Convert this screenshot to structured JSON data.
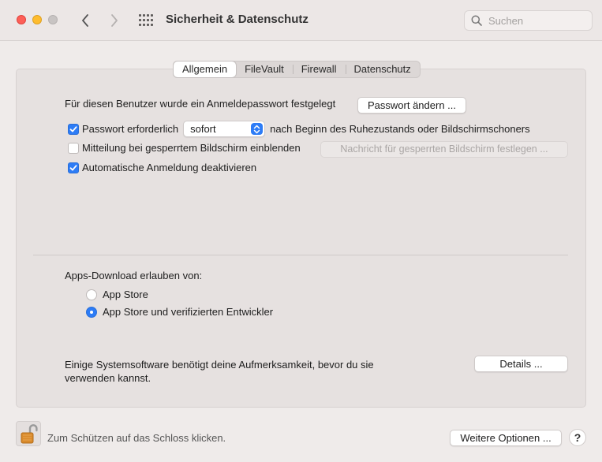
{
  "window": {
    "title": "Sicherheit & Datenschutz",
    "search_placeholder": "Suchen"
  },
  "tabs": [
    {
      "label": "Allgemein",
      "active": true
    },
    {
      "label": "FileVault",
      "active": false
    },
    {
      "label": "Firewall",
      "active": false
    },
    {
      "label": "Datenschutz",
      "active": false
    }
  ],
  "general": {
    "password_set_text": "Für diesen Benutzer wurde ein Anmeldepasswort festgelegt",
    "change_password_button": "Passwort ändern ...",
    "require_password_label": "Passwort erforderlich",
    "require_password_checked": true,
    "require_password_select": "sofort",
    "require_password_suffix": "nach Beginn des Ruhezustands oder Bildschirmschoners",
    "lock_message_label": "Mitteilung bei gesperrtem Bildschirm einblenden",
    "lock_message_checked": false,
    "lock_message_button": "Nachricht für gesperrten Bildschirm festlegen ...",
    "disable_autologin_label": "Automatische Anmeldung deaktivieren",
    "disable_autologin_checked": true
  },
  "downloads": {
    "heading": "Apps-Download erlauben von:",
    "options": [
      {
        "label": "App Store",
        "selected": false
      },
      {
        "label": "App Store und verifizierten Entwickler",
        "selected": true
      }
    ]
  },
  "system_software": {
    "text_line1": "Einige Systemsoftware benötigt deine Aufmerksamkeit, bevor du sie",
    "text_line2": "verwenden kannst.",
    "details_button": "Details ..."
  },
  "footer": {
    "lock_text": "Zum Schützen auf das Schloss klicken.",
    "advanced_button": "Weitere Optionen ...",
    "help_label": "?"
  },
  "colors": {
    "accent": "#2d7cf6",
    "close": "#fd5f57",
    "minimize": "#febc2e"
  }
}
